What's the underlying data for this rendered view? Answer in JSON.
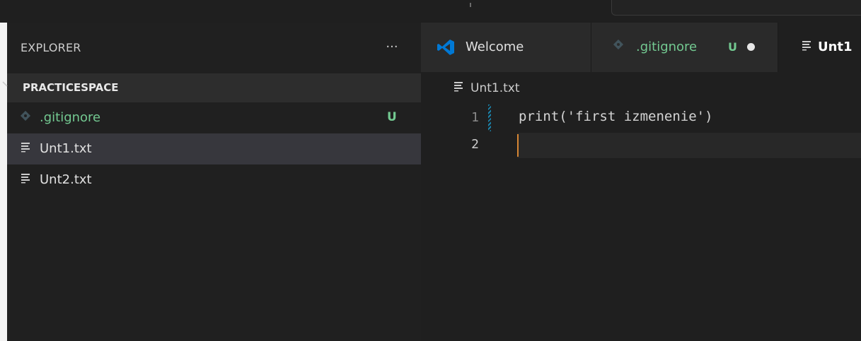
{
  "colors": {
    "accent_blue": "#0078d4",
    "untracked_green": "#73c991",
    "cursor_orange": "#d68534",
    "sidebar_bg": "#202020",
    "editor_bg": "#1f1f1f"
  },
  "explorer": {
    "title": "EXPLORER",
    "more_label": "···",
    "folder": {
      "name": "PRACTICESPACE",
      "chevron": "chevron-down-icon"
    },
    "files": [
      {
        "name": ".gitignore",
        "icon": "git-icon",
        "badge": "U",
        "status": "untracked"
      },
      {
        "name": "Unt1.txt",
        "icon": "text-file-icon",
        "badge": "",
        "status": "selected"
      },
      {
        "name": "Unt2.txt",
        "icon": "text-file-icon",
        "badge": "",
        "status": "normal"
      }
    ]
  },
  "tabs": [
    {
      "label": "Welcome",
      "icon": "vscode-logo-icon"
    },
    {
      "label": ".gitignore",
      "icon": "git-icon",
      "badge": "U",
      "dirty": true
    },
    {
      "label": "Unt1",
      "icon": "text-file-icon",
      "active": true
    }
  ],
  "editor": {
    "breadcrumb": "Unt1.txt",
    "lines": [
      {
        "number": "1",
        "text": "print('first izmenenie')"
      },
      {
        "number": "2",
        "text": ""
      }
    ]
  }
}
